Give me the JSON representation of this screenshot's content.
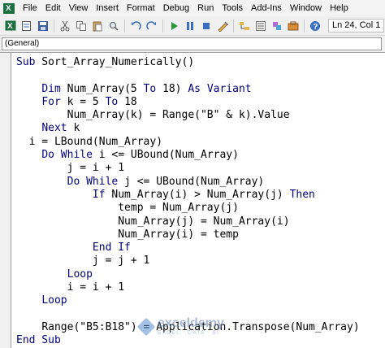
{
  "menu": [
    "File",
    "Edit",
    "View",
    "Insert",
    "Format",
    "Debug",
    "Run",
    "Tools",
    "Add-Ins",
    "Window",
    "Help"
  ],
  "toolbar": {
    "icons": [
      "excel-icon",
      "insert-module-icon",
      "save-icon",
      "cut-icon",
      "copy-icon",
      "paste-icon",
      "find-icon",
      "undo-icon",
      "redo-icon",
      "run-icon",
      "break-icon",
      "reset-icon",
      "design-mode-icon",
      "project-explorer-icon",
      "properties-icon",
      "object-browser-icon",
      "toolbox-icon",
      "help-icon"
    ],
    "status": "Ln 24, Col 1"
  },
  "object_selector": "(General)",
  "code_lines": [
    {
      "indent": "",
      "parts": [
        {
          "t": "Sub",
          "k": 1
        },
        {
          "t": " Sort_Array_Numerically()"
        }
      ]
    },
    {
      "indent": "",
      "parts": []
    },
    {
      "indent": "    ",
      "parts": [
        {
          "t": "Dim",
          "k": 1
        },
        {
          "t": " Num_Array(5 "
        },
        {
          "t": "To",
          "k": 1
        },
        {
          "t": " 18) "
        },
        {
          "t": "As",
          "k": 1
        },
        {
          "t": " "
        },
        {
          "t": "Variant",
          "k": 1
        }
      ]
    },
    {
      "indent": "    ",
      "parts": [
        {
          "t": "For",
          "k": 1
        },
        {
          "t": " k = 5 "
        },
        {
          "t": "To",
          "k": 1
        },
        {
          "t": " 18"
        }
      ]
    },
    {
      "indent": "        ",
      "parts": [
        {
          "t": "Num_Array(k) = Range(\"B\" & k).Value"
        }
      ]
    },
    {
      "indent": "    ",
      "parts": [
        {
          "t": "Next",
          "k": 1
        },
        {
          "t": " k"
        }
      ]
    },
    {
      "indent": "  ",
      "parts": [
        {
          "t": "i = LBound(Num_Array)"
        }
      ]
    },
    {
      "indent": "    ",
      "parts": [
        {
          "t": "Do While",
          "k": 1
        },
        {
          "t": " i <= UBound(Num_Array)"
        }
      ]
    },
    {
      "indent": "        ",
      "parts": [
        {
          "t": "j = i + 1"
        }
      ]
    },
    {
      "indent": "        ",
      "parts": [
        {
          "t": "Do While",
          "k": 1
        },
        {
          "t": " j <= UBound(Num_Array)"
        }
      ]
    },
    {
      "indent": "            ",
      "parts": [
        {
          "t": "If",
          "k": 1
        },
        {
          "t": " Num_Array(i) > Num_Array(j) "
        },
        {
          "t": "Then",
          "k": 1
        }
      ]
    },
    {
      "indent": "                ",
      "parts": [
        {
          "t": "temp = Num_Array(j)"
        }
      ]
    },
    {
      "indent": "                ",
      "parts": [
        {
          "t": "Num_Array(j) = Num_Array(i)"
        }
      ]
    },
    {
      "indent": "                ",
      "parts": [
        {
          "t": "Num_Array(i) = temp"
        }
      ]
    },
    {
      "indent": "            ",
      "parts": [
        {
          "t": "End If",
          "k": 1
        }
      ]
    },
    {
      "indent": "            ",
      "parts": [
        {
          "t": "j = j + 1"
        }
      ]
    },
    {
      "indent": "        ",
      "parts": [
        {
          "t": "Loop",
          "k": 1
        }
      ]
    },
    {
      "indent": "        ",
      "parts": [
        {
          "t": "i = i + 1"
        }
      ]
    },
    {
      "indent": "    ",
      "parts": [
        {
          "t": "Loop",
          "k": 1
        }
      ]
    },
    {
      "indent": "",
      "parts": []
    },
    {
      "indent": "    ",
      "parts": [
        {
          "t": "Range(\"B5:B18\") = Application.Transpose(Num_Array)"
        }
      ]
    },
    {
      "indent": "",
      "parts": [
        {
          "t": "End Sub",
          "k": 1
        }
      ]
    }
  ],
  "watermark": {
    "name": "exceldemy",
    "tagline": "EXCEL · DATA · BI"
  },
  "colors": {
    "keyword": "#00007f",
    "text": "#000000",
    "watermark": "#6a86b3"
  }
}
